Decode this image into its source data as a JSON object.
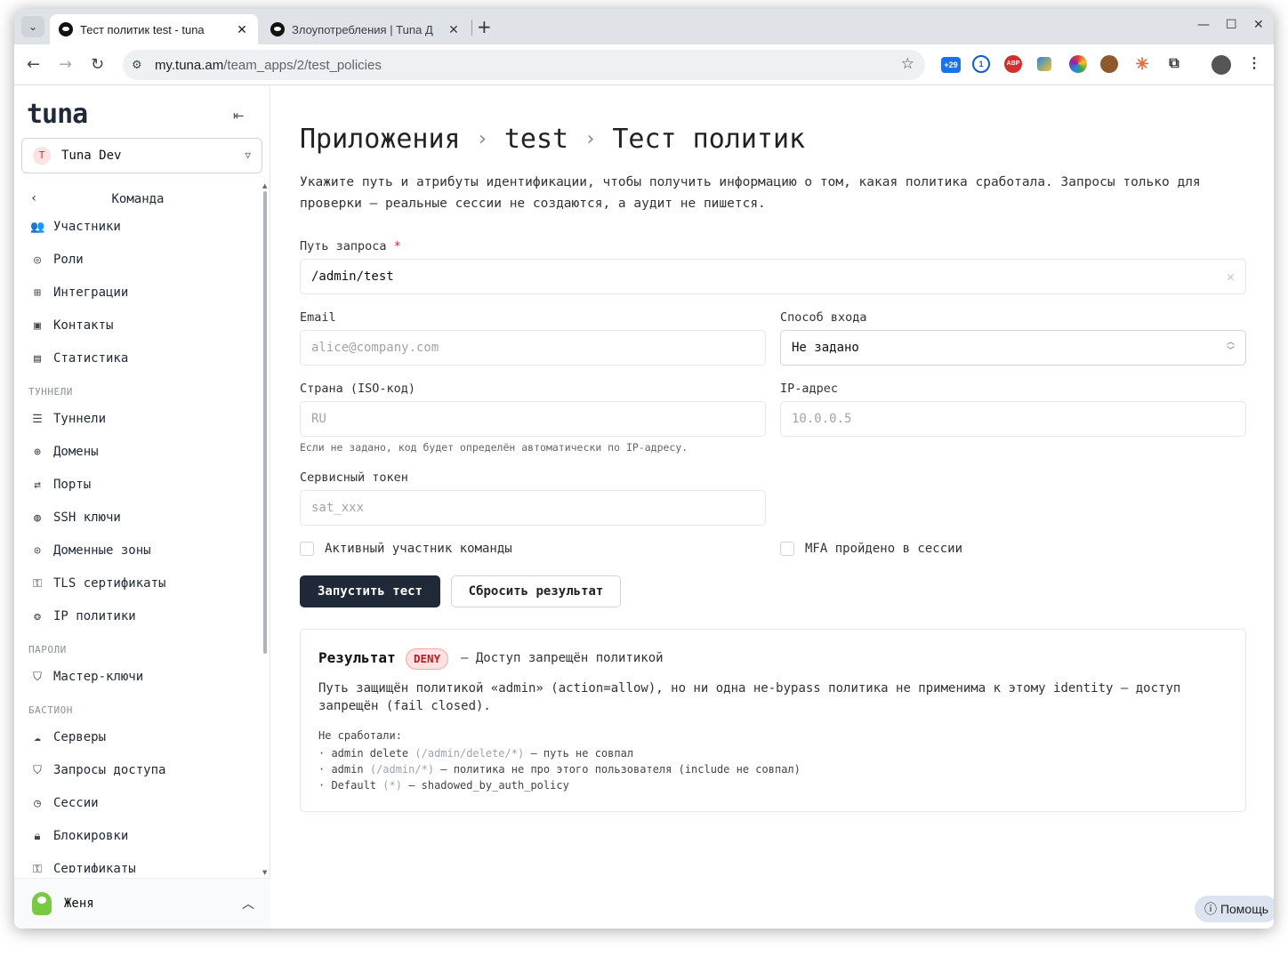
{
  "browser": {
    "tabs": [
      {
        "title": "Тест политик test - tuna",
        "active": true
      },
      {
        "title": "Злоупотребления | Tuna Д",
        "active": false
      }
    ],
    "url_host": "my.tuna.am",
    "url_path": "/team_apps/2/test_policies",
    "extensions": [
      {
        "name": "extension-badge-icon",
        "label": "+29",
        "color": "#1a73e8"
      },
      {
        "name": "onepassword-icon",
        "label": "1",
        "color": "#0b5cd5"
      },
      {
        "name": "adblock-icon",
        "label": "ABP",
        "color": "#d32f2f"
      },
      {
        "name": "extension-color-icon",
        "label": "",
        "color": "#1e88e5"
      },
      {
        "name": "color-wheel-icon",
        "label": "",
        "color": "#43a047"
      },
      {
        "name": "cookie-icon",
        "label": "",
        "color": "#8d5a2b"
      },
      {
        "name": "claude-icon",
        "label": "",
        "color": "#e26a3c"
      }
    ]
  },
  "sidebar": {
    "logo": "tuna",
    "team": {
      "initial": "T",
      "name": "Tuna Dev"
    },
    "back_label": "Команда",
    "groups": [
      {
        "section": "",
        "items": [
          {
            "label": "Участники",
            "icon": "users-icon"
          },
          {
            "label": "Роли",
            "icon": "user-circle-icon"
          },
          {
            "label": "Интеграции",
            "icon": "puzzle-icon"
          },
          {
            "label": "Контакты",
            "icon": "contact-icon"
          },
          {
            "label": "Статистика",
            "icon": "chart-icon"
          }
        ]
      },
      {
        "section": "ТУННЕЛИ",
        "items": [
          {
            "label": "Туннели",
            "icon": "tunnel-icon"
          },
          {
            "label": "Домены",
            "icon": "globe-icon"
          },
          {
            "label": "Порты",
            "icon": "arrows-icon"
          },
          {
            "label": "SSH ключи",
            "icon": "fingerprint-icon"
          },
          {
            "label": "Доменные зоны",
            "icon": "pin-icon"
          },
          {
            "label": "TLS сертификаты",
            "icon": "key-icon"
          },
          {
            "label": "IP политики",
            "icon": "network-icon"
          }
        ]
      },
      {
        "section": "ПАРОЛИ",
        "items": [
          {
            "label": "Мастер-ключи",
            "icon": "shield-check-icon"
          }
        ]
      },
      {
        "section": "БАСТИОН",
        "items": [
          {
            "label": "Серверы",
            "icon": "cloud-icon"
          },
          {
            "label": "Запросы доступа",
            "icon": "shield-icon"
          },
          {
            "label": "Сессии",
            "icon": "clock-icon"
          },
          {
            "label": "Блокировки",
            "icon": "lock-icon"
          },
          {
            "label": "Сертификаты",
            "icon": "key-icon"
          }
        ]
      }
    ],
    "user": {
      "name": "Женя"
    }
  },
  "main": {
    "breadcrumb": [
      "Приложения",
      "test",
      "Тест политик"
    ],
    "lead": "Укажите путь и атрибуты идентификации, чтобы получить информацию о том, какая политика сработала. Запросы только для проверки — реальные сессии не создаются, а аудит не пишется.",
    "form": {
      "path_label": "Путь запроса",
      "path_value": "/admin/test",
      "email_label": "Email",
      "email_placeholder": "alice@company.com",
      "login_label": "Способ входа",
      "login_value": "Не задано",
      "country_label": "Страна (ISO-код)",
      "country_placeholder": "RU",
      "country_hint": "Если не задано, код будет определён автоматически по IP-адресу.",
      "ip_label": "IP-адрес",
      "ip_placeholder": "10.0.0.5",
      "token_label": "Сервисный токен",
      "token_placeholder": "sat_xxx",
      "active_member_label": "Активный участник команды",
      "mfa_label": "MFA пройдено в сессии",
      "run_button": "Запустить тест",
      "reset_button": "Сбросить результат"
    },
    "result": {
      "title": "Результат",
      "badge": "DENY",
      "summary": "— Доступ запрещён политикой",
      "description": "Путь защищён политикой «admin» (action=allow), но ни одна не-bypass политика не применима к этому identity — доступ запрещён (fail closed).",
      "misses_label": "Не сработали:",
      "misses": [
        {
          "prefix": "· admin delete",
          "pattern": "(/admin/delete/*)",
          "reason": "— путь не совпал"
        },
        {
          "prefix": "· admin",
          "pattern": "(/admin/*)",
          "reason": "— политика не про этого пользователя (include не совпал)"
        },
        {
          "prefix": "· Default",
          "pattern": "(*)",
          "reason": "— shadowed_by_auth_policy"
        }
      ]
    },
    "help_label": "Помощь"
  }
}
